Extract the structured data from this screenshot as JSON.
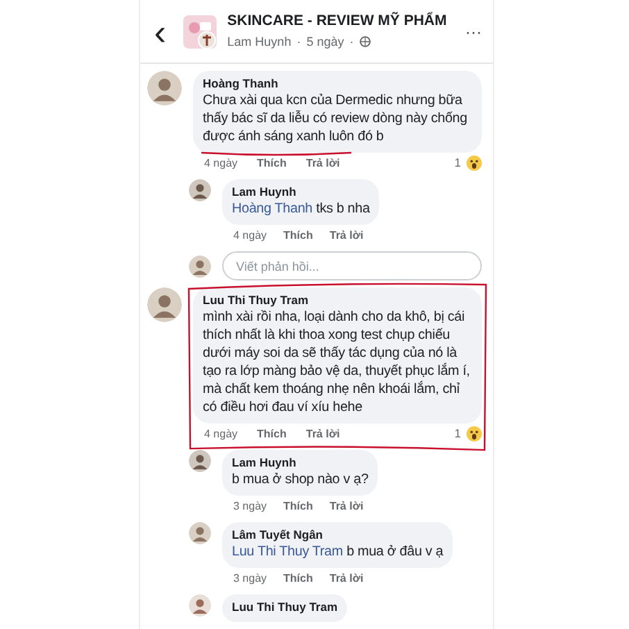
{
  "header": {
    "back": "‹",
    "title": "SKINCARE - REVIEW MỸ PHẨM",
    "author": "Lam Huynh",
    "time": "5 ngày",
    "separators": [
      "·",
      "·"
    ],
    "more": "···"
  },
  "comments": [
    {
      "kind": "top",
      "author": "Hoàng Thanh",
      "text": "Chưa xài qua kcn của Dermedic nhưng bữa thấy bác sĩ da liễu có review dòng này chống được ánh sáng xanh luôn đó b",
      "time": "4 ngày",
      "like": "Thích",
      "reply": "Trả lời",
      "reactions": "1",
      "underlined": true
    },
    {
      "kind": "reply",
      "author": "Lam Huynh",
      "mention": "Hoàng Thanh",
      "text": "tks b nha",
      "time": "4 ngày",
      "like": "Thích",
      "reply": "Trả lời"
    },
    {
      "kind": "input",
      "placeholder": "Viết phản hồi..."
    },
    {
      "kind": "top",
      "author": "Luu Thi Thuy Tram",
      "text": "mình xài rồi nha, loại dành cho da khô, bị cái thích nhất là khi thoa xong test chụp chiếu dưới máy soi da sẽ thấy tác dụng của nó là tạo ra lớp màng bảo vệ da, thuyết phục lắm í, mà chất kem thoáng nhẹ nên khoái lắm, chỉ có điều hơi đau ví xíu hehe",
      "time": "4 ngày",
      "like": "Thích",
      "reply": "Trả lời",
      "reactions": "1",
      "boxed": true
    },
    {
      "kind": "reply",
      "author": "Lam Huynh",
      "text": "b mua ở shop nào v ạ?",
      "time": "3 ngày",
      "like": "Thích",
      "reply": "Trả lời"
    },
    {
      "kind": "reply",
      "author": "Lâm Tuyết Ngân",
      "mention": "Luu Thi Thuy Tram",
      "text": "b mua ở đâu v ạ",
      "time": "3 ngày",
      "like": "Thích",
      "reply": "Trả lời"
    },
    {
      "kind": "reply",
      "author": "Luu Thi Thuy Tram"
    }
  ]
}
